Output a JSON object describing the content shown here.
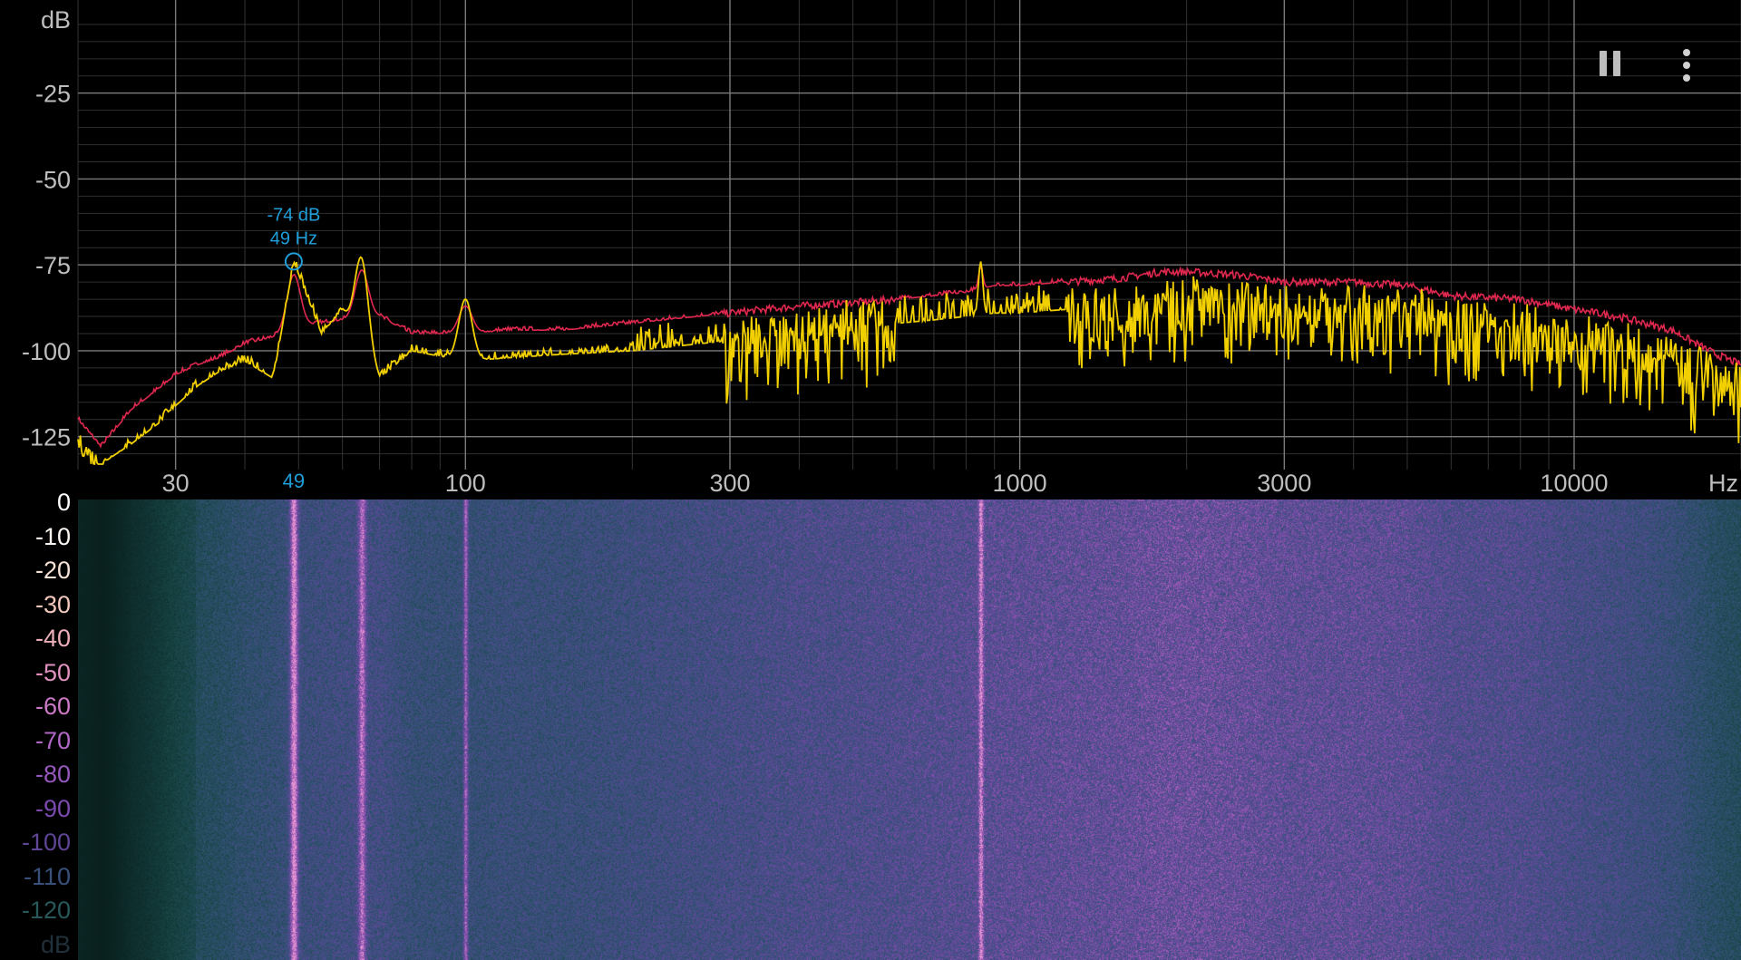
{
  "spectrum": {
    "y_unit_label": "dB",
    "x_unit_label": "Hz",
    "y_ticks": [
      "-25",
      "-50",
      "-75",
      "-100",
      "-125"
    ],
    "x_ticks": [
      "30",
      "100",
      "300",
      "1000",
      "3000",
      "10000"
    ],
    "peak_marker": {
      "db_label": "-74 dB",
      "hz_label": "49 Hz",
      "axis_label": "49",
      "frequency_hz": 49,
      "level_db": -74
    }
  },
  "chart_data": {
    "type": "line",
    "xscale": "log",
    "xlim": [
      20,
      20000
    ],
    "ylim": [
      -133,
      0
    ],
    "series": [
      {
        "color": "#e0284f",
        "x": [
          20,
          22,
          25,
          28,
          30,
          33,
          36,
          40,
          45,
          49,
          55,
          60,
          70,
          80,
          100,
          120,
          150,
          200,
          300,
          400,
          500,
          600,
          700,
          800,
          900,
          1000,
          1200,
          1500,
          1800,
          2000,
          2500,
          3000,
          4000,
          5000,
          6000,
          8000,
          10000,
          12000,
          15000,
          18000,
          20000
        ],
        "y": [
          -120,
          -128,
          -117,
          -111,
          -107,
          -104,
          -102,
          -98,
          -96,
          -93,
          -92,
          -91,
          -90,
          -95,
          -95,
          -94,
          -94,
          -92,
          -89,
          -87,
          -86,
          -85,
          -84,
          -83,
          -81,
          -81,
          -80,
          -79,
          -77,
          -77,
          -78,
          -80,
          -80,
          -81,
          -84,
          -85,
          -88,
          -90,
          -94,
          -101,
          -104
        ]
      },
      {
        "color": "#f2d000",
        "x": [
          20,
          22,
          25,
          28,
          30,
          33,
          36,
          40,
          45,
          49,
          55,
          60,
          70,
          80,
          100,
          120,
          150,
          200,
          300,
          400,
          500,
          600,
          700,
          800,
          900,
          1000,
          1200,
          1500,
          1800,
          2000,
          2500,
          3000,
          4000,
          5000,
          6000,
          8000,
          10000,
          12000,
          15000,
          18000,
          20000
        ],
        "y": [
          -126,
          -133,
          -127,
          -121,
          -116,
          -110,
          -106,
          -103,
          -108,
          -74,
          -95,
          -88,
          -108,
          -100,
          -103,
          -102,
          -101,
          -100,
          -97,
          -95,
          -93,
          -92,
          -91,
          -90,
          -89,
          -89,
          -88,
          -87,
          -86,
          -86,
          -87,
          -88,
          -88,
          -89,
          -92,
          -93,
          -97,
          -99,
          -103,
          -108,
          -112
        ]
      }
    ],
    "peaks": [
      {
        "x": 49,
        "y": -74
      },
      {
        "x": 65,
        "y": -73
      },
      {
        "x": 100,
        "y": -85
      },
      {
        "x": 850,
        "y": -74
      }
    ]
  },
  "spectrogram": {
    "scale_labels": [
      "0",
      "-10",
      "-20",
      "-30",
      "-40",
      "-50",
      "-60",
      "-70",
      "-80",
      "-90",
      "-100",
      "-110",
      "-120",
      "dB"
    ],
    "scale_colors": [
      "#ffffff",
      "#fbf6f0",
      "#f7e2d6",
      "#f2c8bd",
      "#ecaeb8",
      "#e091c0",
      "#cd7ac6",
      "#b269c6",
      "#9658bd",
      "#7b4aae",
      "#5e4596",
      "#39507a",
      "#28585a",
      "#20303a"
    ]
  },
  "controls": {
    "pause_icon": "pause-icon",
    "menu_icon": "more-vertical-icon"
  }
}
